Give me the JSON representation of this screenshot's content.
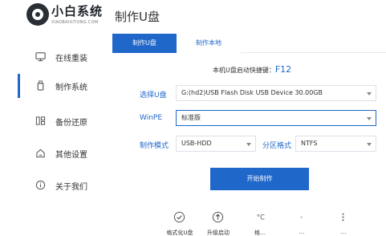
{
  "header": {
    "brand": "小白系统",
    "brand_sub": "XIAOBAIXITONG.COM",
    "page_title": "制作U盘"
  },
  "sidebar": {
    "items": [
      {
        "label": "在线重装",
        "icon": "monitor-icon"
      },
      {
        "label": "制作系统",
        "icon": "usb-drive-icon",
        "active": true
      },
      {
        "label": "备份还原",
        "icon": "backup-icon"
      },
      {
        "label": "其他设置",
        "icon": "home-settings-icon"
      },
      {
        "label": "关于我们",
        "icon": "info-icon"
      }
    ]
  },
  "tabs": [
    {
      "label": "制作U盘",
      "active": true
    },
    {
      "label": "制作本地",
      "active": false
    }
  ],
  "hotkey": {
    "text": "本机U盘启动快捷键：",
    "key": "F12"
  },
  "form": {
    "usb_label": "选择U盘",
    "usb_value": "G:(hd2)USB Flash Disk USB Device 30.00GB",
    "winpe_label": "WinPE",
    "winpe_value": "标准版",
    "mode_label": "制作模式",
    "mode_value": "USB-HDD",
    "partition_label": "分区格式",
    "partition_value": "NTFS"
  },
  "start_button": "开始制作",
  "tools": [
    {
      "label": "格式化U盘",
      "icon": "check-circle-icon"
    },
    {
      "label": "升级启动",
      "icon": "upload-arrow-icon"
    },
    {
      "label": "格…",
      "icon": "convert-icon"
    },
    {
      "label": "…",
      "icon": "restore-icon"
    },
    {
      "label": "…",
      "icon": "shortcut-icon"
    }
  ],
  "colors": {
    "accent": "#1f67c9",
    "border": "#dde2e8"
  }
}
